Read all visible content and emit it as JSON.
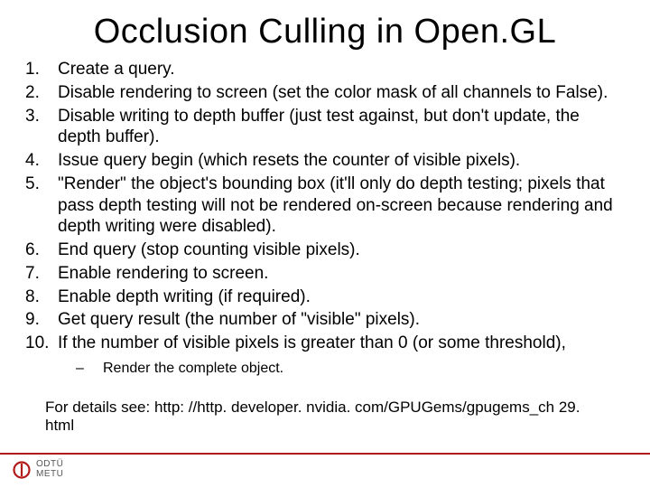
{
  "title": "Occlusion Culling in Open.GL",
  "steps": [
    {
      "n": "1.",
      "t": "Create a query."
    },
    {
      "n": "2.",
      "t": "Disable rendering to screen (set the color mask of all channels to False)."
    },
    {
      "n": "3.",
      "t": "Disable writing to depth buffer (just test against, but don't update, the depth buffer)."
    },
    {
      "n": "4.",
      "t": "Issue query begin (which resets the counter of visible pixels)."
    },
    {
      "n": "5.",
      "t": "\"Render\" the object's bounding box (it'll only do depth testing; pixels that pass depth testing will not be rendered on-screen because rendering and depth writing were disabled)."
    },
    {
      "n": "6.",
      "t": "End query (stop counting visible pixels)."
    },
    {
      "n": "7.",
      "t": "Enable rendering to screen."
    },
    {
      "n": "8.",
      "t": "Enable depth writing (if required)."
    },
    {
      "n": "9.",
      "t": "Get query result (the number of \"visible\" pixels)."
    },
    {
      "n": "10.",
      "t": "If the number of visible pixels is greater than 0 (or some threshold),"
    }
  ],
  "substeps": [
    {
      "dash": "–",
      "t": "Render the complete object."
    }
  ],
  "details": "For details see: http: //http. developer. nvidia. com/GPUGems/gpugems_ch 29. html",
  "logo": {
    "line1": "ODTÜ",
    "line2": "METU"
  }
}
